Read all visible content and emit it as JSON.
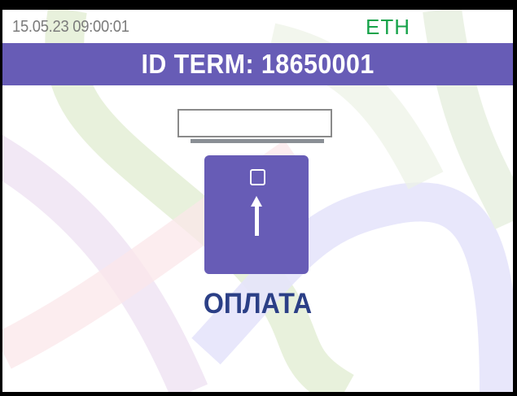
{
  "status_bar": {
    "datetime": "15.05.23 09:00:01",
    "connection": "ETH"
  },
  "header": {
    "title": "ID TERM: 18650001"
  },
  "main": {
    "action_label": "ОПЛАТА"
  },
  "icons": {
    "card_slot": "card-slot-icon",
    "insert_card": "card-insert-icon",
    "chip": "chip-icon",
    "arrow": "arrow-up-icon"
  },
  "colors": {
    "header_bg": "#675cb6",
    "connection": "#17a34a",
    "action_label": "#2b3f86"
  }
}
